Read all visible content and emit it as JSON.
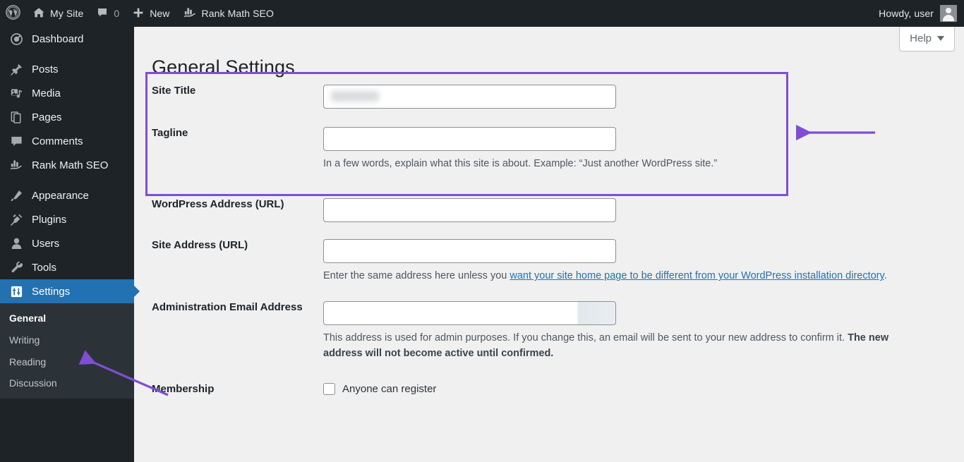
{
  "adminbar": {
    "logo_icon": "wordpress-logo-icon",
    "site_name": "My Site",
    "home_icon": "home-icon",
    "comments_icon": "comment-bubble-icon",
    "comment_count": "0",
    "new_icon": "plus-icon",
    "new_label": "New",
    "rankmath_icon": "rank-math-icon",
    "rankmath_label": "Rank Math SEO",
    "howdy": "Howdy, user",
    "avatar": "user-avatar"
  },
  "sidebar": {
    "items": [
      {
        "label": "Dashboard",
        "icon": "dashboard-icon",
        "current": false,
        "gap": false
      },
      {
        "label": "Posts",
        "icon": "pin-icon",
        "current": false,
        "gap": true
      },
      {
        "label": "Media",
        "icon": "media-icon",
        "current": false,
        "gap": false
      },
      {
        "label": "Pages",
        "icon": "pages-icon",
        "current": false,
        "gap": false
      },
      {
        "label": "Comments",
        "icon": "comment-bubble-icon",
        "current": false,
        "gap": false
      },
      {
        "label": "Rank Math SEO",
        "icon": "rank-math-icon",
        "current": false,
        "gap": false
      },
      {
        "label": "Appearance",
        "icon": "appearance-brush-icon",
        "current": false,
        "gap": true
      },
      {
        "label": "Plugins",
        "icon": "plugin-plug-icon",
        "current": false,
        "gap": false
      },
      {
        "label": "Users",
        "icon": "user-icon",
        "current": false,
        "gap": false
      },
      {
        "label": "Tools",
        "icon": "wrench-icon",
        "current": false,
        "gap": false
      },
      {
        "label": "Settings",
        "icon": "settings-sliders-icon",
        "current": true,
        "gap": false
      }
    ],
    "submenu": [
      {
        "label": "General",
        "active": true
      },
      {
        "label": "Writing",
        "active": false
      },
      {
        "label": "Reading",
        "active": false
      },
      {
        "label": "Discussion",
        "active": false
      }
    ]
  },
  "help_tab": {
    "label": "Help",
    "caret_icon": "chevron-down-icon"
  },
  "page": {
    "title": "General Settings"
  },
  "form": {
    "site_title": {
      "label": "Site Title",
      "value": "",
      "redacted": true
    },
    "tagline": {
      "label": "Tagline",
      "value": "",
      "description": "In a few words, explain what this site is about. Example: “Just another WordPress site.”"
    },
    "wordpress_address": {
      "label": "WordPress Address (URL)",
      "value": ""
    },
    "site_address": {
      "label": "Site Address (URL)",
      "value": "",
      "desc_before": "Enter the same address here unless you ",
      "desc_link": "want your site home page to be different from your WordPress installation directory",
      "desc_after": "."
    },
    "admin_email": {
      "label": "Administration Email Address",
      "value": "",
      "desc_normal": "This address is used for admin purposes. If you change this, an email will be sent to your new address to confirm it. ",
      "desc_bold": "The new address will not become active until confirmed."
    },
    "membership": {
      "label": "Membership",
      "checkbox_label": "Anyone can register",
      "checked": false
    }
  },
  "annotations": {
    "highlight_color": "#7e4fd1",
    "arrow_to_settings_fields": "arrow-left",
    "arrow_to_settings_menu": "arrow-up-left"
  }
}
